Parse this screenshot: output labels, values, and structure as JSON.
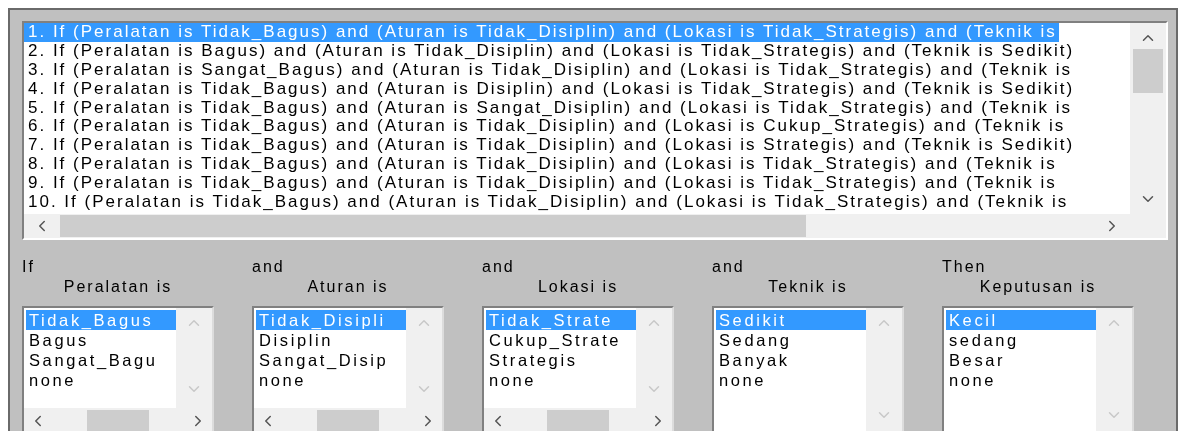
{
  "rules": {
    "items": [
      {
        "text": "1. If (Peralatan is Tidak_Bagus) and (Aturan is Tidak_Disiplin) and (Lokasi is Tidak_Strategis) and (Teknik is",
        "selected": true
      },
      {
        "text": "2. If (Peralatan is Bagus) and (Aturan is Tidak_Disiplin) and (Lokasi is Tidak_Strategis) and (Teknik is Sedikit)",
        "selected": false
      },
      {
        "text": "3. If (Peralatan is Sangat_Bagus) and (Aturan is Tidak_Disiplin) and (Lokasi is Tidak_Strategis) and (Teknik is",
        "selected": false
      },
      {
        "text": "4. If (Peralatan is Tidak_Bagus) and (Aturan is Disiplin) and (Lokasi is Tidak_Strategis) and (Teknik is Sedikit)",
        "selected": false
      },
      {
        "text": "5. If (Peralatan is Tidak_Bagus) and (Aturan is Sangat_Disiplin) and (Lokasi is Tidak_Strategis) and (Teknik is",
        "selected": false
      },
      {
        "text": "6. If (Peralatan is Tidak_Bagus) and (Aturan is Tidak_Disiplin) and (Lokasi is Cukup_Strategis) and (Teknik is",
        "selected": false
      },
      {
        "text": "7. If (Peralatan is Tidak_Bagus) and (Aturan is Tidak_Disiplin) and (Lokasi is Strategis) and (Teknik is Sedikit)",
        "selected": false
      },
      {
        "text": "8. If (Peralatan is Tidak_Bagus) and (Aturan is Tidak_Disiplin) and (Lokasi is Tidak_Strategis) and (Teknik is",
        "selected": false
      },
      {
        "text": "9. If (Peralatan is Tidak_Bagus) and (Aturan is Tidak_Disiplin) and (Lokasi is Tidak_Strategis) and (Teknik is",
        "selected": false
      },
      {
        "text": "10. If (Peralatan is Tidak_Bagus) and (Aturan is Tidak_Disiplin) and (Lokasi is Tidak_Strategis) and (Teknik is",
        "selected": false
      }
    ]
  },
  "columns": [
    {
      "connector": "If",
      "label": "Peralatan is",
      "kind": "wide",
      "items": [
        {
          "text": "Tidak_Bagus",
          "selected": true
        },
        {
          "text": "Bagus",
          "selected": false
        },
        {
          "text": "Sangat_Bagu",
          "selected": false
        },
        {
          "text": "none",
          "selected": false
        }
      ]
    },
    {
      "connector": "and",
      "label": "Aturan is",
      "kind": "wide",
      "items": [
        {
          "text": "Tidak_Disipli",
          "selected": true
        },
        {
          "text": "Disiplin",
          "selected": false
        },
        {
          "text": "Sangat_Disip",
          "selected": false
        },
        {
          "text": "none",
          "selected": false
        }
      ]
    },
    {
      "connector": "and",
      "label": "Lokasi is",
      "kind": "wide",
      "items": [
        {
          "text": "Tidak_Strate",
          "selected": true
        },
        {
          "text": "Cukup_Strate",
          "selected": false
        },
        {
          "text": "Strategis",
          "selected": false
        },
        {
          "text": "none",
          "selected": false
        }
      ]
    },
    {
      "connector": "and",
      "label": "Teknik is",
      "kind": "fit",
      "items": [
        {
          "text": "Sedikit",
          "selected": true
        },
        {
          "text": "Sedang",
          "selected": false
        },
        {
          "text": "Banyak",
          "selected": false
        },
        {
          "text": "none",
          "selected": false
        }
      ]
    },
    {
      "connector": "Then",
      "label": "Keputusan is",
      "kind": "fit",
      "items": [
        {
          "text": "Kecil",
          "selected": true
        },
        {
          "text": "sedang",
          "selected": false
        },
        {
          "text": "Besar",
          "selected": false
        },
        {
          "text": "none",
          "selected": false
        }
      ]
    }
  ]
}
